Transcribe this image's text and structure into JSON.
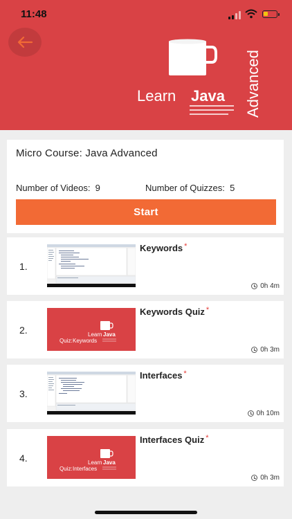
{
  "status_bar": {
    "time": "11:48"
  },
  "header": {
    "logo_text_learn": "Learn",
    "logo_text_java": "Java",
    "logo_text_advanced": "Advanced",
    "color": "#d94245"
  },
  "course": {
    "title": "Micro Course: Java Advanced",
    "videos_label": "Number of Videos:",
    "videos_count": "9",
    "quizzes_label": "Number of Quizzes:",
    "quizzes_count": "5",
    "start_label": "Start",
    "accent": "#f26a35"
  },
  "items": [
    {
      "number": "1.",
      "title": "Keywords",
      "required": "*",
      "duration": "0h 4m",
      "type": "video"
    },
    {
      "number": "2.",
      "title": "Keywords Quiz",
      "required": "*",
      "duration": "0h 3m",
      "type": "quiz",
      "thumb_learn": "Learn",
      "thumb_java": "Java",
      "thumb_quiz_prefix": "Quiz:",
      "thumb_quiz_name": "Keywords"
    },
    {
      "number": "3.",
      "title": "Interfaces",
      "required": "*",
      "duration": "0h 10m",
      "type": "video"
    },
    {
      "number": "4.",
      "title": "Interfaces Quiz",
      "required": "*",
      "duration": "0h 3m",
      "type": "quiz",
      "thumb_learn": "Learn",
      "thumb_java": "Java",
      "thumb_quiz_prefix": "Quiz:",
      "thumb_quiz_name": "Interfaces"
    }
  ]
}
